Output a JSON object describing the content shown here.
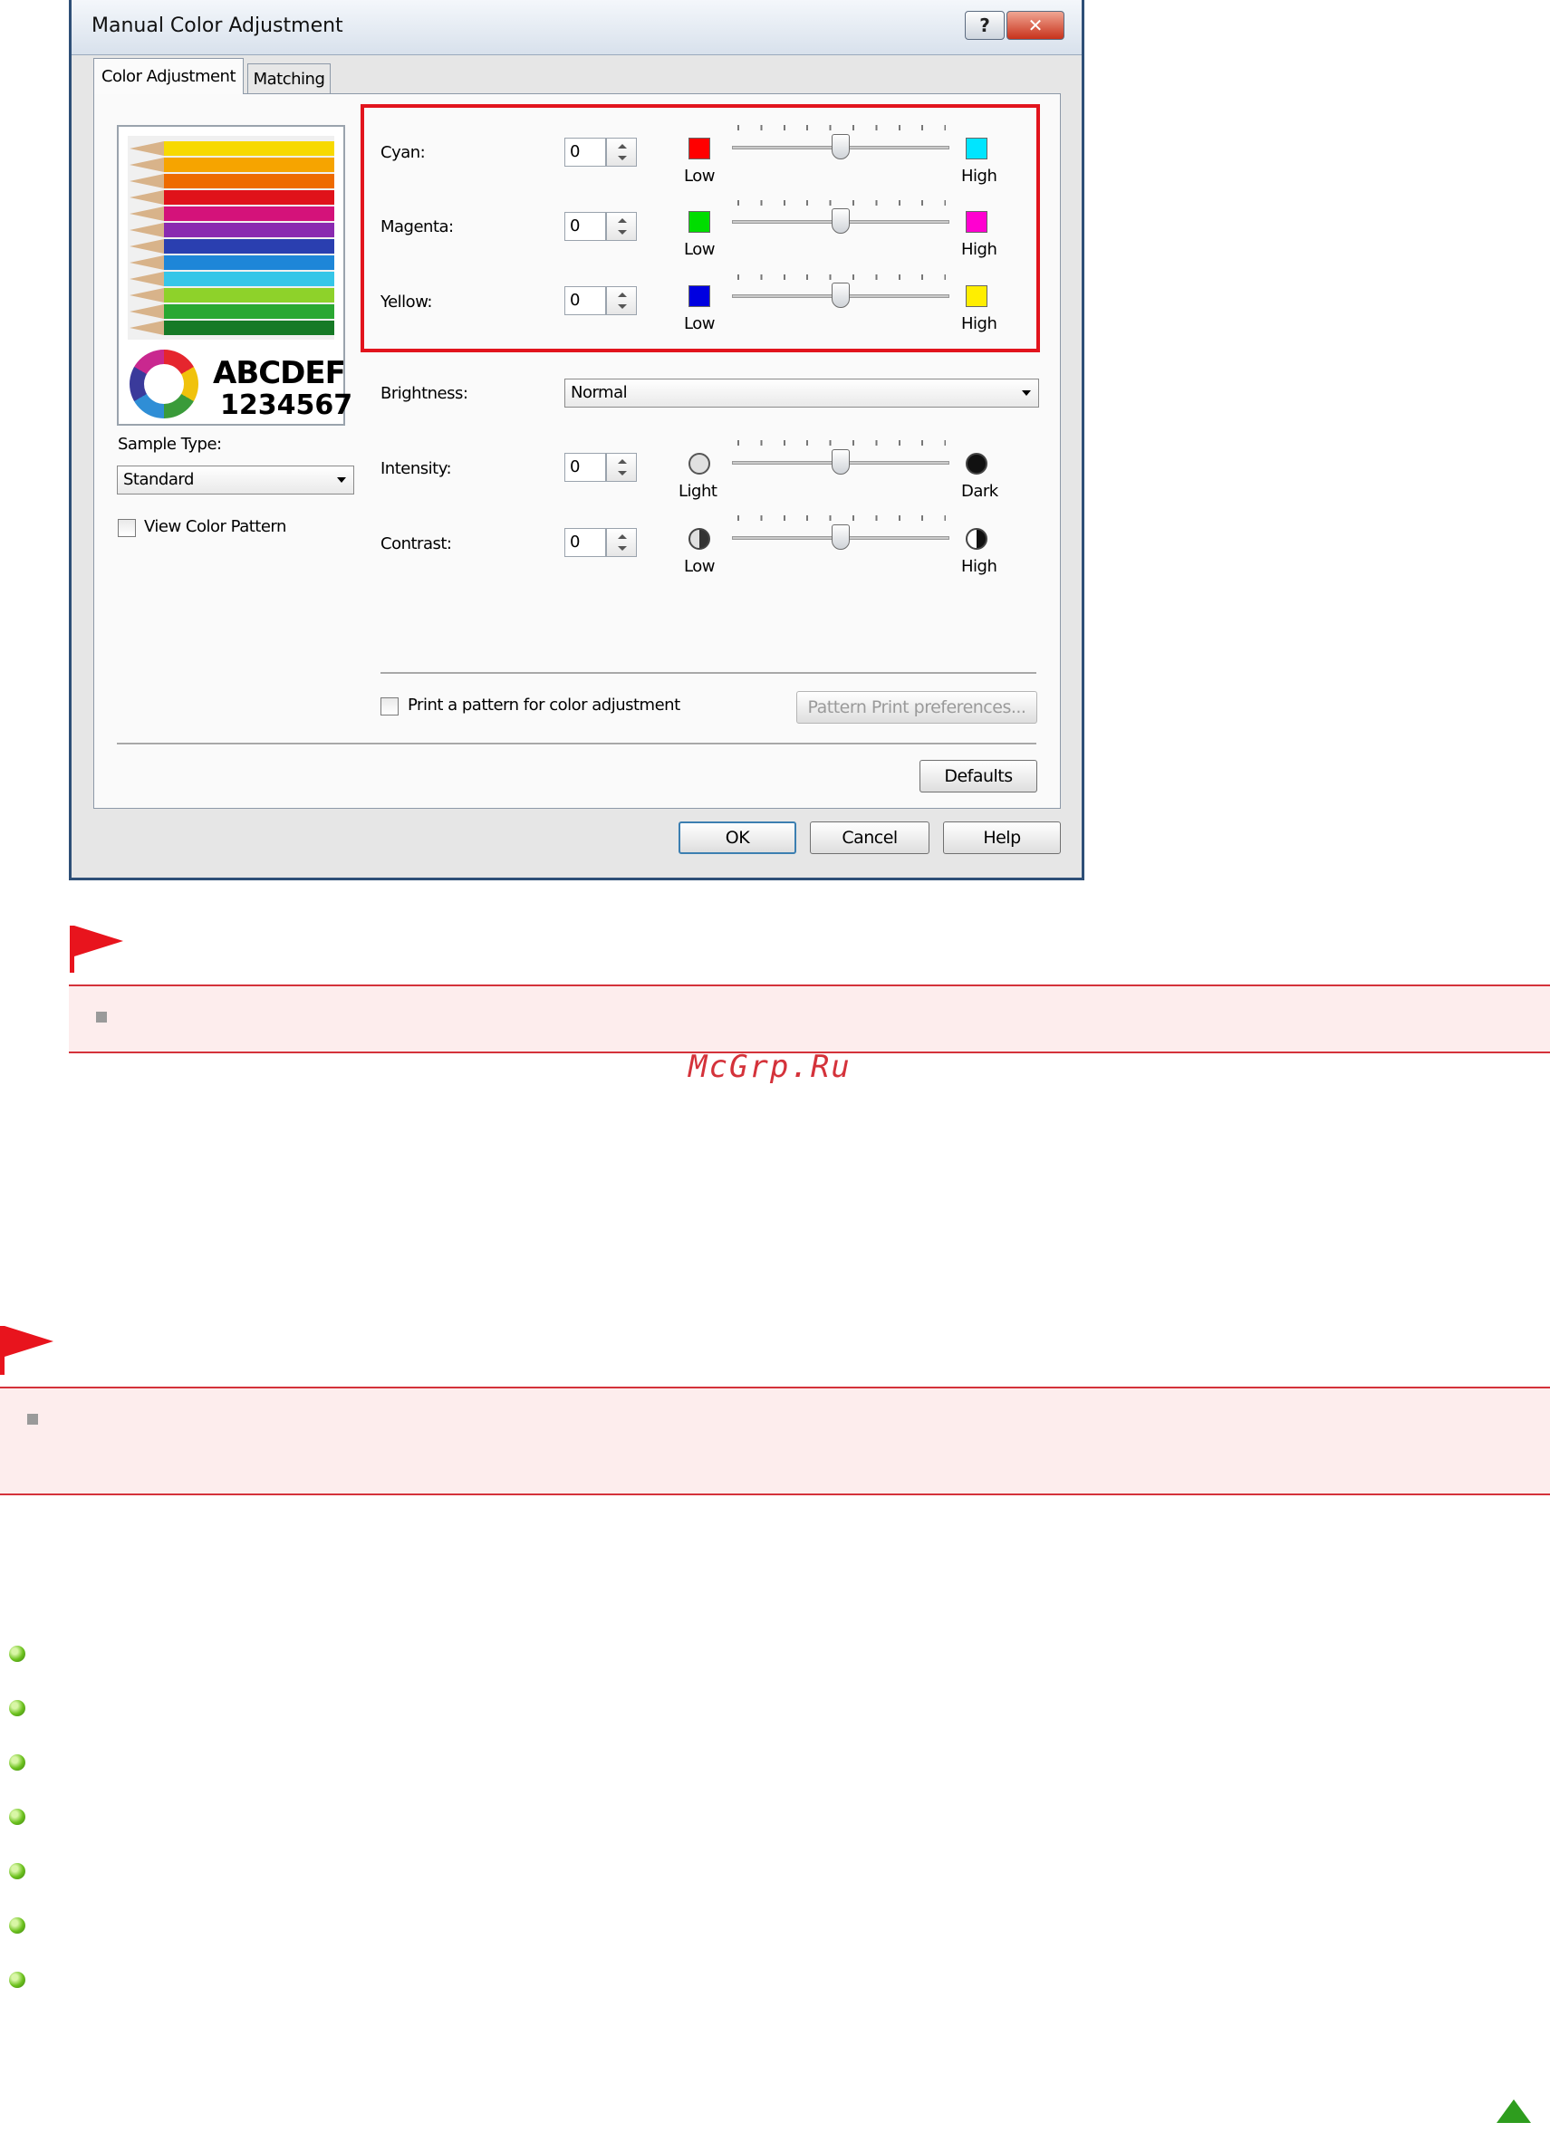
{
  "dialog": {
    "title": "Manual Color Adjustment",
    "help_button": "?",
    "close_button": "✕",
    "tabs": [
      {
        "label": "Color Adjustment",
        "active": true
      },
      {
        "label": "Matching",
        "active": false
      }
    ],
    "preview": {
      "line1": "ABCDEF",
      "line2": "1234567"
    },
    "sample_type": {
      "label": "Sample Type:",
      "value": "Standard"
    },
    "view_color_pattern": {
      "label": "View Color Pattern",
      "checked": false
    },
    "color_sliders": [
      {
        "label": "Cyan:",
        "value": "0",
        "low_label": "Low",
        "high_label": "High",
        "low_color": "#ff0000",
        "high_color": "#00e5ff",
        "slider_position": 0.5
      },
      {
        "label": "Magenta:",
        "value": "0",
        "low_label": "Low",
        "high_label": "High",
        "low_color": "#00dd00",
        "high_color": "#ff00d0",
        "slider_position": 0.5
      },
      {
        "label": "Yellow:",
        "value": "0",
        "low_label": "Low",
        "high_label": "High",
        "low_color": "#0000e0",
        "high_color": "#ffee00",
        "slider_position": 0.5
      }
    ],
    "brightness": {
      "label": "Brightness:",
      "value": "Normal"
    },
    "intensity": {
      "label": "Intensity:",
      "value": "0",
      "low_label": "Light",
      "high_label": "Dark",
      "slider_position": 0.5
    },
    "contrast": {
      "label": "Contrast:",
      "value": "0",
      "low_label": "Low",
      "high_label": "High",
      "slider_position": 0.5
    },
    "print_pattern": {
      "label": "Print a pattern for color adjustment",
      "checked": false
    },
    "pattern_print_preferences": "Pattern Print preferences...",
    "defaults": "Defaults",
    "ok": "OK",
    "cancel": "Cancel",
    "help": "Help",
    "highlight_color": "#e2141d"
  },
  "watermark": "McGrp.Ru",
  "colors": {
    "flag": "#e8141d",
    "note_background": "#fdeded",
    "note_border": "#d4323a",
    "bullet_green": "#6cc11e"
  },
  "bullet_list_count": 7
}
